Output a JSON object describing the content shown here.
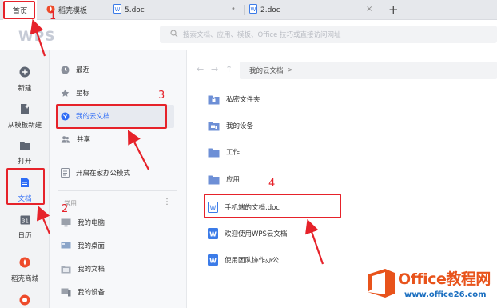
{
  "tabs": {
    "home_label": "首页",
    "tab1_label": "稻壳模板",
    "tab2_label": "5.doc",
    "tab3_label": "2.doc",
    "close_glyph": "•",
    "close2_glyph": "×",
    "new_tab_glyph": "+"
  },
  "header": {
    "logo_text": "WPS",
    "search_placeholder": "搜索文档、应用、模板、Office 技巧或直接访问网址"
  },
  "left_nav": {
    "items": [
      {
        "label": "新建",
        "icon": "plus-circle-icon"
      },
      {
        "label": "从模板新建",
        "icon": "template-icon"
      },
      {
        "label": "打开",
        "icon": "folder-open-icon"
      },
      {
        "label": "文档",
        "icon": "document-icon"
      },
      {
        "label": "日历",
        "icon": "calendar-icon"
      },
      {
        "label": "稻壳商城",
        "icon": "docer-store-icon"
      }
    ]
  },
  "mid_nav": {
    "items": [
      {
        "label": "最近",
        "icon": "clock-icon"
      },
      {
        "label": "星标",
        "icon": "star-icon"
      },
      {
        "label": "我的云文档",
        "icon": "cloud-docs-icon"
      },
      {
        "label": "共享",
        "icon": "share-users-icon"
      },
      {
        "label": "开启在家办公模式",
        "icon": "home-office-icon"
      }
    ],
    "section_label": "常用",
    "section_more": "⋮",
    "common_items": [
      {
        "label": "我的电脑",
        "icon": "computer-icon"
      },
      {
        "label": "我的桌面",
        "icon": "desktop-icon"
      },
      {
        "label": "我的文档",
        "icon": "my-docs-icon"
      },
      {
        "label": "我的设备",
        "icon": "device-icon"
      }
    ]
  },
  "content": {
    "breadcrumb": "我的云文档",
    "breadcrumb_chevron": ">",
    "nav_back": "←",
    "nav_forward": "→",
    "nav_up": "↑",
    "files": [
      {
        "name": "私密文件夹",
        "icon": "private-folder-icon"
      },
      {
        "name": "我的设备",
        "icon": "device-folder-icon"
      },
      {
        "name": "工作",
        "icon": "folder-icon"
      },
      {
        "name": "应用",
        "icon": "folder-icon"
      },
      {
        "name": "手机端的文档.doc",
        "icon": "word-doc-outline-icon"
      },
      {
        "name": "欢迎使用WPS云文档",
        "icon": "word-doc-icon"
      },
      {
        "name": "使用团队协作办公",
        "icon": "word-doc-icon"
      }
    ]
  },
  "annotations": {
    "n1": "1",
    "n2": "2",
    "n3": "3",
    "n4": "4",
    "color": "#e6222a"
  },
  "watermark": {
    "main": "Office教程网",
    "sub": "www.office26.com"
  },
  "colors": {
    "accent_blue": "#2e6cf6",
    "word_blue": "#3b7be8",
    "folder_blue": "#6d8fd6",
    "annotation_red": "#e6222a"
  }
}
